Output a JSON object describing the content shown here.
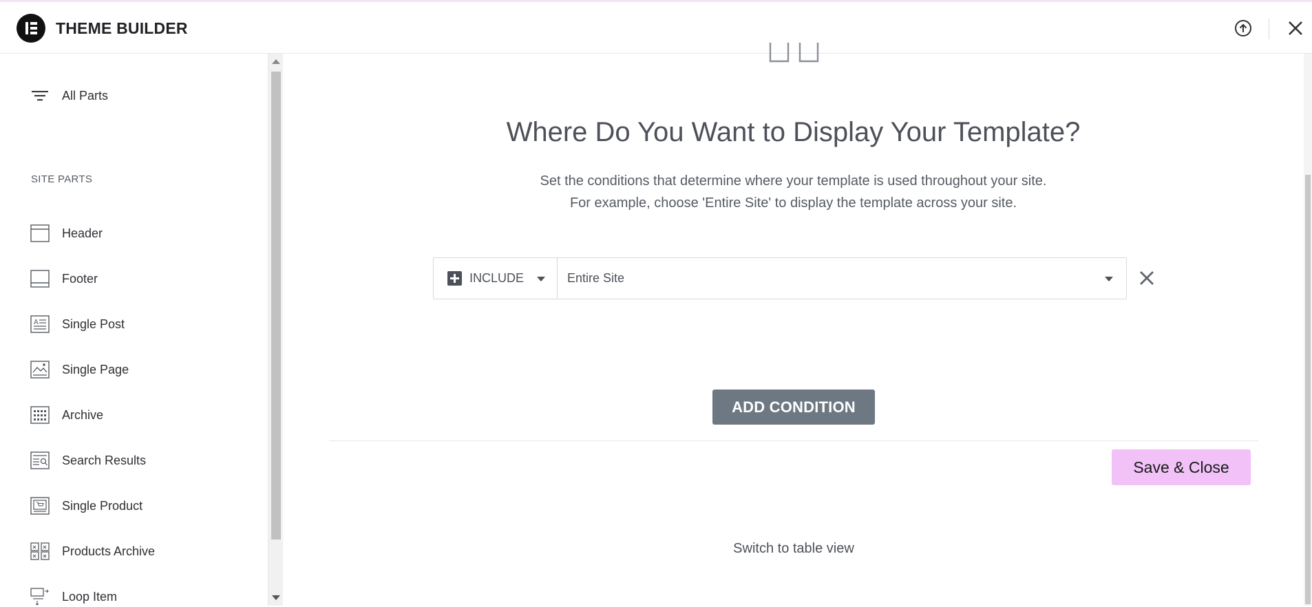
{
  "header": {
    "title": "THEME BUILDER",
    "logo_icon": "elementor-logo-icon",
    "upload_icon": "upload-circle-icon",
    "close_icon": "close-icon"
  },
  "sidebar": {
    "all_parts_label": "All Parts",
    "section_title": "SITE PARTS",
    "items": [
      {
        "label": "Header",
        "icon": "header-layout-icon"
      },
      {
        "label": "Footer",
        "icon": "footer-layout-icon"
      },
      {
        "label": "Single Post",
        "icon": "single-post-icon"
      },
      {
        "label": "Single Page",
        "icon": "single-page-icon"
      },
      {
        "label": "Archive",
        "icon": "archive-grid-icon"
      },
      {
        "label": "Search Results",
        "icon": "search-results-icon"
      },
      {
        "label": "Single Product",
        "icon": "single-product-icon"
      },
      {
        "label": "Products Archive",
        "icon": "products-archive-icon"
      },
      {
        "label": "Loop Item",
        "icon": "loop-item-icon"
      }
    ]
  },
  "main": {
    "heading": "Where Do You Want to Display Your Template?",
    "description_line1": "Set the conditions that determine where your template is used throughout your site.",
    "description_line2": "For example, choose 'Entire Site' to display the template across your site.",
    "condition": {
      "type_label": "INCLUDE",
      "value": "Entire Site"
    },
    "add_condition_label": "ADD CONDITION",
    "save_label": "Save & Close",
    "switch_view_label": "Switch to table view"
  },
  "colors": {
    "accent_save": "#f1c1f7",
    "add_button": "#6d7882",
    "text_dark": "#4c5058"
  }
}
